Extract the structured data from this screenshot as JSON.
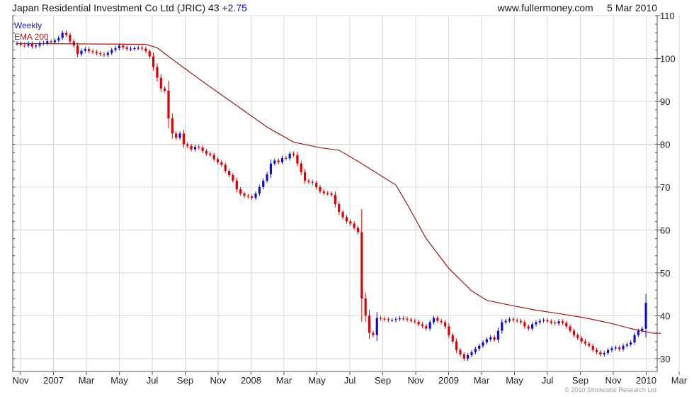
{
  "header": {
    "name": "Japan Residential Investment Co Ltd",
    "ticker": "(JRIC)",
    "price": "43",
    "change": "+2.75",
    "site": "www.fullermoney.com",
    "date": "5 Mar 2010"
  },
  "copyright": "© 2010 Stockcube Research Ltd",
  "chart_data": {
    "type": "candlestick",
    "legend": [
      "Weekly",
      "EMA 200"
    ],
    "x_ticks": [
      "Nov",
      "2007",
      "Mar",
      "May",
      "Jul",
      "Sep",
      "Nov",
      "2008",
      "Mar",
      "May",
      "Jul",
      "Sep",
      "Nov",
      "2009",
      "Mar",
      "May",
      "Jul",
      "Sep",
      "Nov",
      "2010",
      "Mar"
    ],
    "y_ticks": [
      30,
      40,
      50,
      60,
      70,
      80,
      90,
      100,
      110
    ],
    "ylim": [
      27,
      110
    ],
    "grid": true,
    "colors": {
      "up": "#1010cc",
      "down": "#dd0000",
      "ema": "#a01818",
      "grid": "#d8d8d8"
    },
    "series": [
      {
        "name": "Weekly",
        "kind": "candlestick",
        "close": [
          103.5,
          103.2,
          103,
          103.5,
          102.8,
          103,
          103.6,
          103.5,
          104,
          103.8,
          104.2,
          104.8,
          106,
          105.5,
          104,
          103,
          101,
          101.8,
          102.2,
          101.7,
          101.5,
          101.2,
          101,
          100.8,
          101.3,
          102,
          102.4,
          103,
          102.6,
          102.2,
          102.3,
          102.4,
          102.5,
          102.3,
          101.7,
          100.5,
          98,
          95.5,
          93,
          92.5,
          86,
          82.5,
          81.5,
          82.5,
          80,
          79.6,
          78.8,
          79.4,
          79.2,
          78.4,
          77.8,
          77.5,
          76.5,
          75.8,
          75.2,
          73.8,
          72.8,
          71.5,
          69.5,
          68.5,
          68,
          67.8,
          67.5,
          68.5,
          70,
          71.5,
          73,
          75.5,
          76.2,
          75.8,
          76.8,
          76.7,
          77.8,
          77.5,
          75.5,
          73.5,
          71.5,
          71.2,
          71,
          70,
          69,
          68.6,
          68.5,
          68.2,
          66,
          64.2,
          63,
          62,
          61.5,
          60.5,
          59.5,
          44,
          40,
          36,
          35.5,
          39.5,
          39.3,
          39.2,
          39,
          39,
          39.2,
          39.4,
          39.3,
          39.1,
          38.8,
          38.6,
          38,
          37.6,
          37,
          38.5,
          39.5,
          38.8,
          38.5,
          37.5,
          35.5,
          34,
          32,
          31,
          30,
          30.8,
          31.5,
          32.3,
          33,
          33.8,
          34.5,
          35,
          34.4,
          36.5,
          38.5,
          38.8,
          39.2,
          39,
          38.8,
          38.5,
          37.5,
          37,
          38,
          38.5,
          38.8,
          39,
          38.7,
          38.4,
          38.2,
          38.7,
          38.3,
          37.5,
          36.5,
          35.5,
          34.8,
          34,
          33.5,
          33,
          32,
          31.5,
          31,
          31.3,
          32,
          32.4,
          32.6,
          32.2,
          33,
          33.3,
          33.8,
          35.5,
          36.5,
          37,
          43
        ]
      },
      {
        "name": "EMA 200",
        "kind": "line",
        "points": [
          [
            0,
            103.5
          ],
          [
            15,
            103.4
          ],
          [
            34,
            103.3
          ],
          [
            37,
            102.5
          ],
          [
            43,
            98.5
          ],
          [
            50,
            94
          ],
          [
            58,
            89
          ],
          [
            66,
            84
          ],
          [
            73,
            80.5
          ],
          [
            80,
            79.2
          ],
          [
            85,
            78.6
          ],
          [
            90,
            76
          ],
          [
            100,
            70.5
          ],
          [
            103,
            66
          ],
          [
            108,
            58
          ],
          [
            114,
            51
          ],
          [
            120,
            45.8
          ],
          [
            124,
            43.6
          ],
          [
            130,
            42.5
          ],
          [
            137,
            41.3
          ],
          [
            143,
            40.5
          ],
          [
            150,
            39.5
          ],
          [
            157,
            38.2
          ],
          [
            162,
            37
          ],
          [
            168,
            35.9
          ],
          [
            170,
            35.9
          ]
        ]
      }
    ]
  }
}
